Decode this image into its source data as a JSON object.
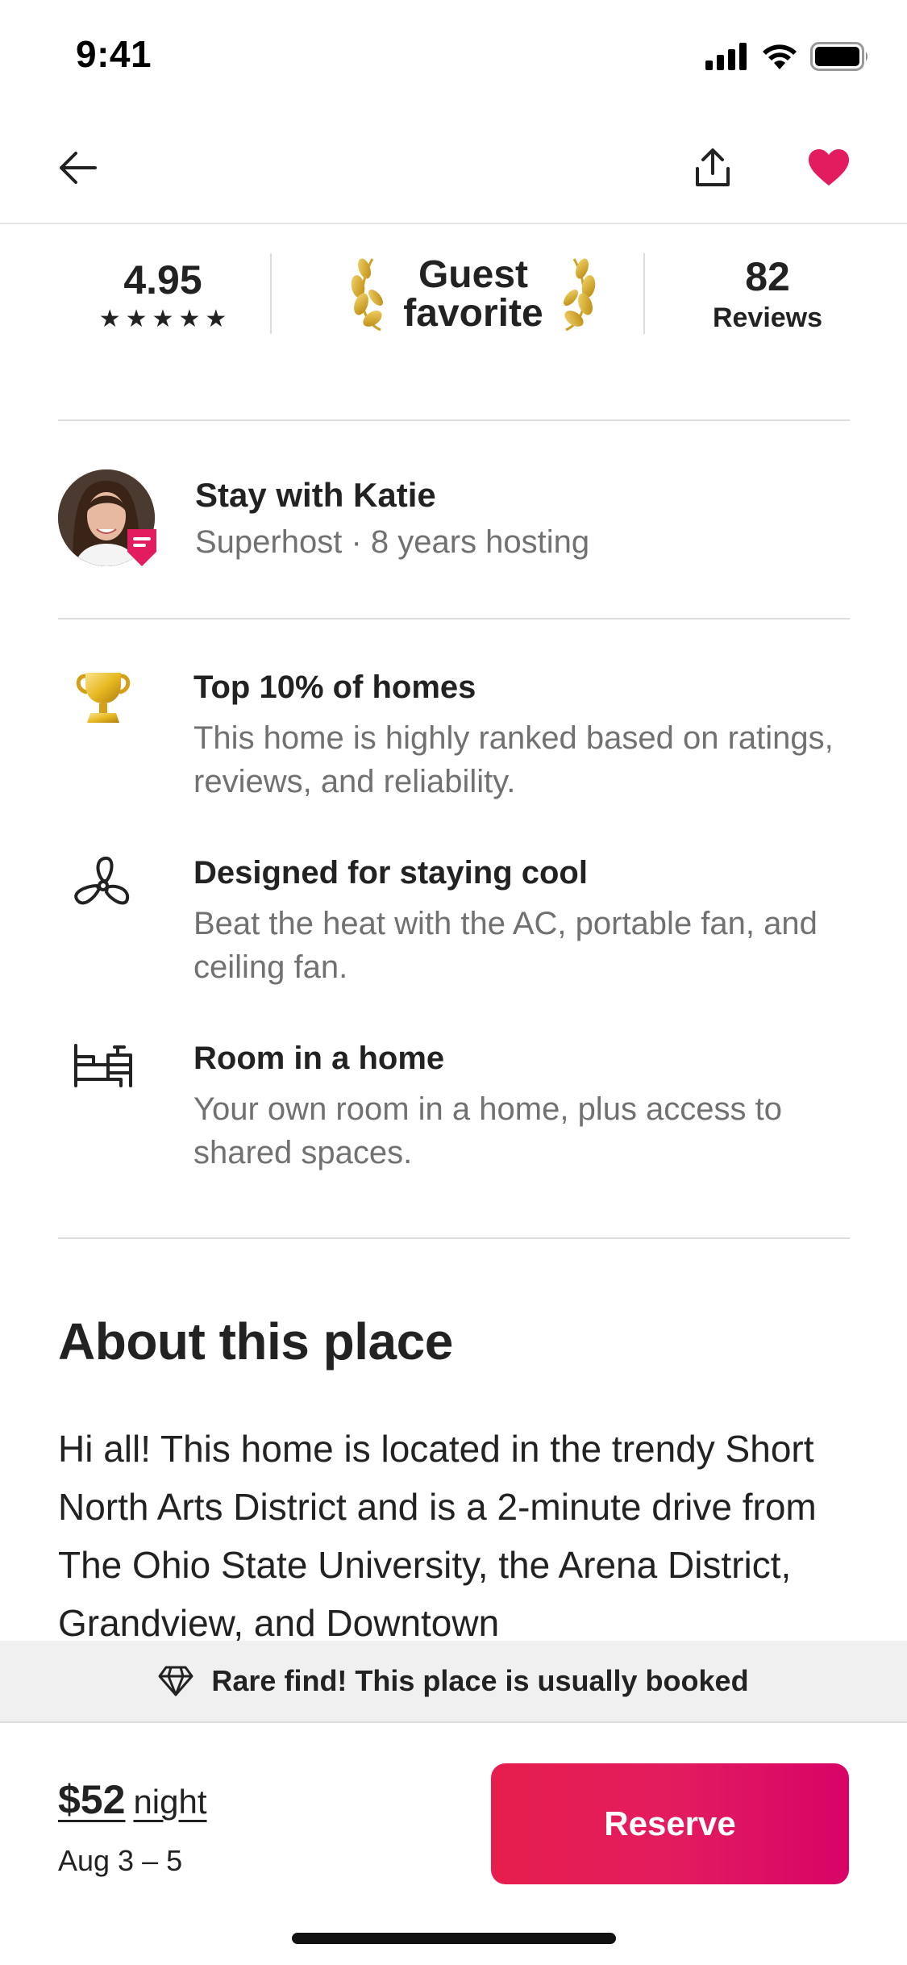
{
  "status_bar": {
    "time": "9:41"
  },
  "summary": {
    "rating": "4.95",
    "stars": [
      "★",
      "★",
      "★",
      "★",
      "★"
    ],
    "guest_favorite_line1": "Guest",
    "guest_favorite_line2": "favorite",
    "reviews_count": "82",
    "reviews_label": "Reviews"
  },
  "host": {
    "name": "Stay with Katie",
    "meta": "Superhost · 8 years hosting"
  },
  "highlights": [
    {
      "icon": "trophy-icon",
      "title": "Top 10% of homes",
      "desc": "This home is highly ranked based on ratings, reviews, and reliability."
    },
    {
      "icon": "fan-icon",
      "title": "Designed for staying cool",
      "desc": "Beat the heat with the AC, portable fan, and ceiling fan."
    },
    {
      "icon": "bed-icon",
      "title": "Room in a home",
      "desc": "Your own room in a home, plus access to shared spaces."
    }
  ],
  "about": {
    "title": "About this place",
    "text": "Hi all! This home is located in the trendy Short North Arts District and is a 2-minute drive from The Ohio State University, the Arena District, Grandview, and Downtown"
  },
  "banner": {
    "icon": "diamond-icon",
    "text": "Rare find! This place is usually booked"
  },
  "footer": {
    "price": "$52",
    "price_unit": "night",
    "dates": "Aug 3 – 5",
    "reserve_label": "Reserve"
  },
  "colors": {
    "brand": "#E31C5F",
    "heart": "#E31C5F",
    "muted_text": "#717171",
    "text": "#222222",
    "gold": "#D4A017"
  }
}
